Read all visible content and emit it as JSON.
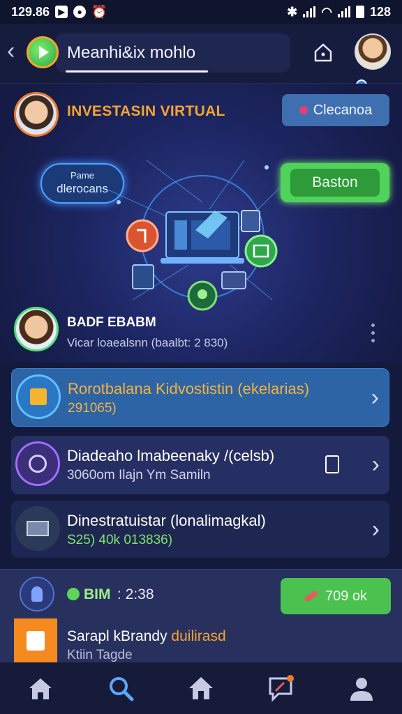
{
  "status_bar": {
    "time": "129.86",
    "right": "128"
  },
  "app_bar": {
    "title": "Meanhi&ix mohlo"
  },
  "hero": {
    "title": "INVESTASIN VIRTUAL",
    "clear_button": "Clecanoa",
    "pill_line1": "Pame",
    "pill_line2": "dlerocans",
    "green_button": "Baston",
    "profile_name": "BADF EBABM",
    "profile_subtitle": "Vicar loaealsnn (baalbt: 2 830)"
  },
  "list": [
    {
      "title": "Rorotbalana Kidvostistin (ekelarias)",
      "subtitle": "291065)"
    },
    {
      "title": "Diadeaho lmabeenaky /(celsb)",
      "subtitle": "3060om Ilajn  Ym Samiln"
    },
    {
      "title": "Dinestratuistar (lonalimagkal)",
      "subtitle": "S25) 40k 013836)"
    }
  ],
  "bottom_panel": {
    "label": "BIM",
    "time": ": 2:38",
    "button": "709 ok",
    "title_white": "Sarapl kBrandy ",
    "title_orange": "duilirasd",
    "subtitle": "Ktiin Tagde"
  },
  "colors": {
    "accent_orange": "#f5a431",
    "accent_green": "#4fd35a",
    "background": "#141a3c"
  }
}
